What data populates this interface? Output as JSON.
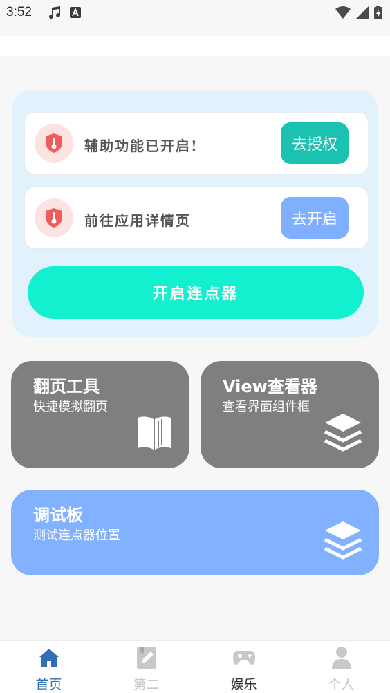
{
  "status_bar": {
    "time": "3:52",
    "left_icons": [
      "music-note-icon",
      "a-box-icon"
    ],
    "right_icons": [
      "wifi-icon",
      "signal-icon",
      "battery-icon"
    ]
  },
  "accessibility_panel": {
    "rows": [
      {
        "label": "辅助功能已开启!",
        "button_label": "去授权",
        "icon": "shield-thermometer-icon",
        "button_color": "#1cc2b1"
      },
      {
        "label": "前往应用详情页",
        "button_label": "去开启",
        "icon": "shield-thermometer-icon",
        "button_color": "#7fb0ff"
      }
    ],
    "main_button_label": "开启连点器",
    "main_button_color": "#12f0d0"
  },
  "tiles": [
    {
      "title": "翻页工具",
      "subtitle": "快捷模拟翻页",
      "icon": "book-icon",
      "color": "#7f7f7f"
    },
    {
      "title": "View查看器",
      "subtitle": "查看界面组件框",
      "icon": "layers-icon",
      "color": "#7f7f7f"
    },
    {
      "title": "调试板",
      "subtitle": "测试连点器位置",
      "icon": "layers-icon",
      "color": "#82b1ff"
    }
  ],
  "bottom_nav": {
    "items": [
      {
        "label": "首页",
        "icon": "home-icon",
        "active": true
      },
      {
        "label": "第二",
        "icon": "edit-note-icon",
        "active": false
      },
      {
        "label": "娱乐",
        "icon": "gamepad-icon",
        "active": false
      },
      {
        "label": "个人",
        "icon": "person-icon",
        "active": false
      }
    ],
    "active_color": "#2f6fb4"
  }
}
